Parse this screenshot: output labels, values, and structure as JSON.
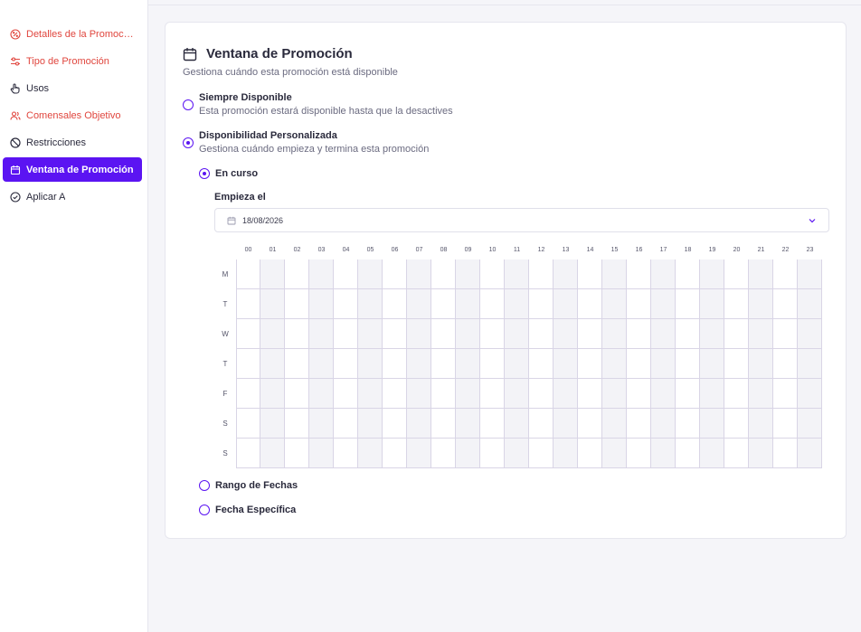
{
  "sidebar": {
    "items": [
      {
        "label": "Detalles de la Promoción",
        "icon": "percent-badge-icon",
        "state": "error"
      },
      {
        "label": "Tipo de Promoción",
        "icon": "sliders-icon",
        "state": "error"
      },
      {
        "label": "Usos",
        "icon": "hand-pointer-icon",
        "state": "normal"
      },
      {
        "label": "Comensales Objetivo",
        "icon": "users-icon",
        "state": "error"
      },
      {
        "label": "Restricciones",
        "icon": "ban-icon",
        "state": "normal"
      },
      {
        "label": "Ventana de Promoción",
        "icon": "calendar-icon",
        "state": "active"
      },
      {
        "label": "Aplicar A",
        "icon": "check-circle-icon",
        "state": "normal"
      }
    ]
  },
  "card": {
    "title": "Ventana de Promoción",
    "subtitle": "Gestiona cuándo esta promoción está disponible",
    "options": {
      "always": {
        "title": "Siempre Disponible",
        "desc": "Esta promoción estará disponible hasta que la desactives",
        "checked": false
      },
      "custom": {
        "title": "Disponibilidad Personalizada",
        "desc": "Gestiona cuándo empieza y termina esta promoción",
        "checked": true
      }
    },
    "sub_options": {
      "ongoing": {
        "label": "En curso",
        "checked": true
      },
      "date_range": {
        "label": "Rango de Fechas",
        "checked": false
      },
      "specific_date": {
        "label": "Fecha Específica",
        "checked": false
      }
    },
    "start_label": "Empieza el",
    "start_date": "18/08/2026"
  },
  "schedule": {
    "hours": [
      "00",
      "01",
      "02",
      "03",
      "04",
      "05",
      "06",
      "07",
      "08",
      "09",
      "10",
      "11",
      "12",
      "13",
      "14",
      "15",
      "16",
      "17",
      "18",
      "19",
      "20",
      "21",
      "22",
      "23"
    ],
    "days": [
      "M",
      "T",
      "W",
      "T",
      "F",
      "S",
      "S"
    ]
  },
  "colors": {
    "accent": "#5b14f2",
    "error": "#e0463e"
  }
}
